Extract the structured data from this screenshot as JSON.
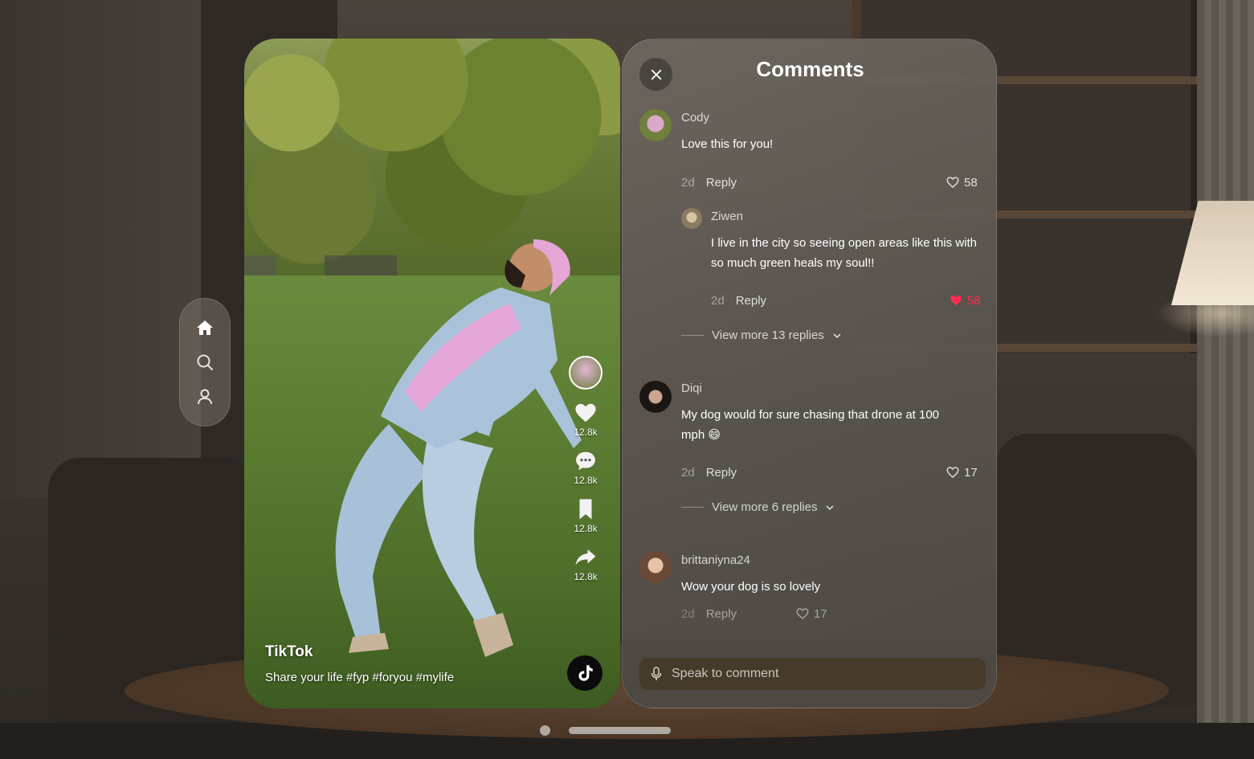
{
  "nav": {
    "items": [
      {
        "id": "home",
        "icon": "home-icon",
        "active": true
      },
      {
        "id": "search",
        "icon": "search-icon",
        "active": false
      },
      {
        "id": "profile",
        "icon": "profile-icon",
        "active": false
      }
    ]
  },
  "video": {
    "title": "TikTok",
    "description": "Share your life #fyp #foryou #mylife",
    "actions": {
      "likes": "12.8k",
      "comments": "12.8k",
      "saves": "12.8k",
      "shares": "12.8k"
    }
  },
  "comments_panel": {
    "title": "Comments",
    "input_placeholder": "Speak to comment",
    "accent_like_color": "#fe2c55",
    "comments": [
      {
        "user": "Cody",
        "text": "Love this for you!",
        "time": "2d",
        "reply_label": "Reply",
        "likes": "58",
        "liked": false
      },
      {
        "user": "Ziwen",
        "text": "I live in the city so seeing open areas like this with so much green heals my soul!!",
        "time": "2d",
        "reply_label": "Reply",
        "likes": "58",
        "liked": true,
        "is_reply": true
      },
      {
        "view_more": "View more 13 replies"
      },
      {
        "user": "Diqi",
        "text": "My dog would for sure chasing that drone at 100 mph 😄",
        "time": "2d",
        "reply_label": "Reply",
        "likes": "17",
        "liked": false
      },
      {
        "view_more": "View more 6 replies"
      },
      {
        "user": "brittaniyna24",
        "text": "Wow your dog is so lovely",
        "time": "2d",
        "reply_label": "Reply",
        "likes": "17",
        "liked": false
      }
    ]
  }
}
